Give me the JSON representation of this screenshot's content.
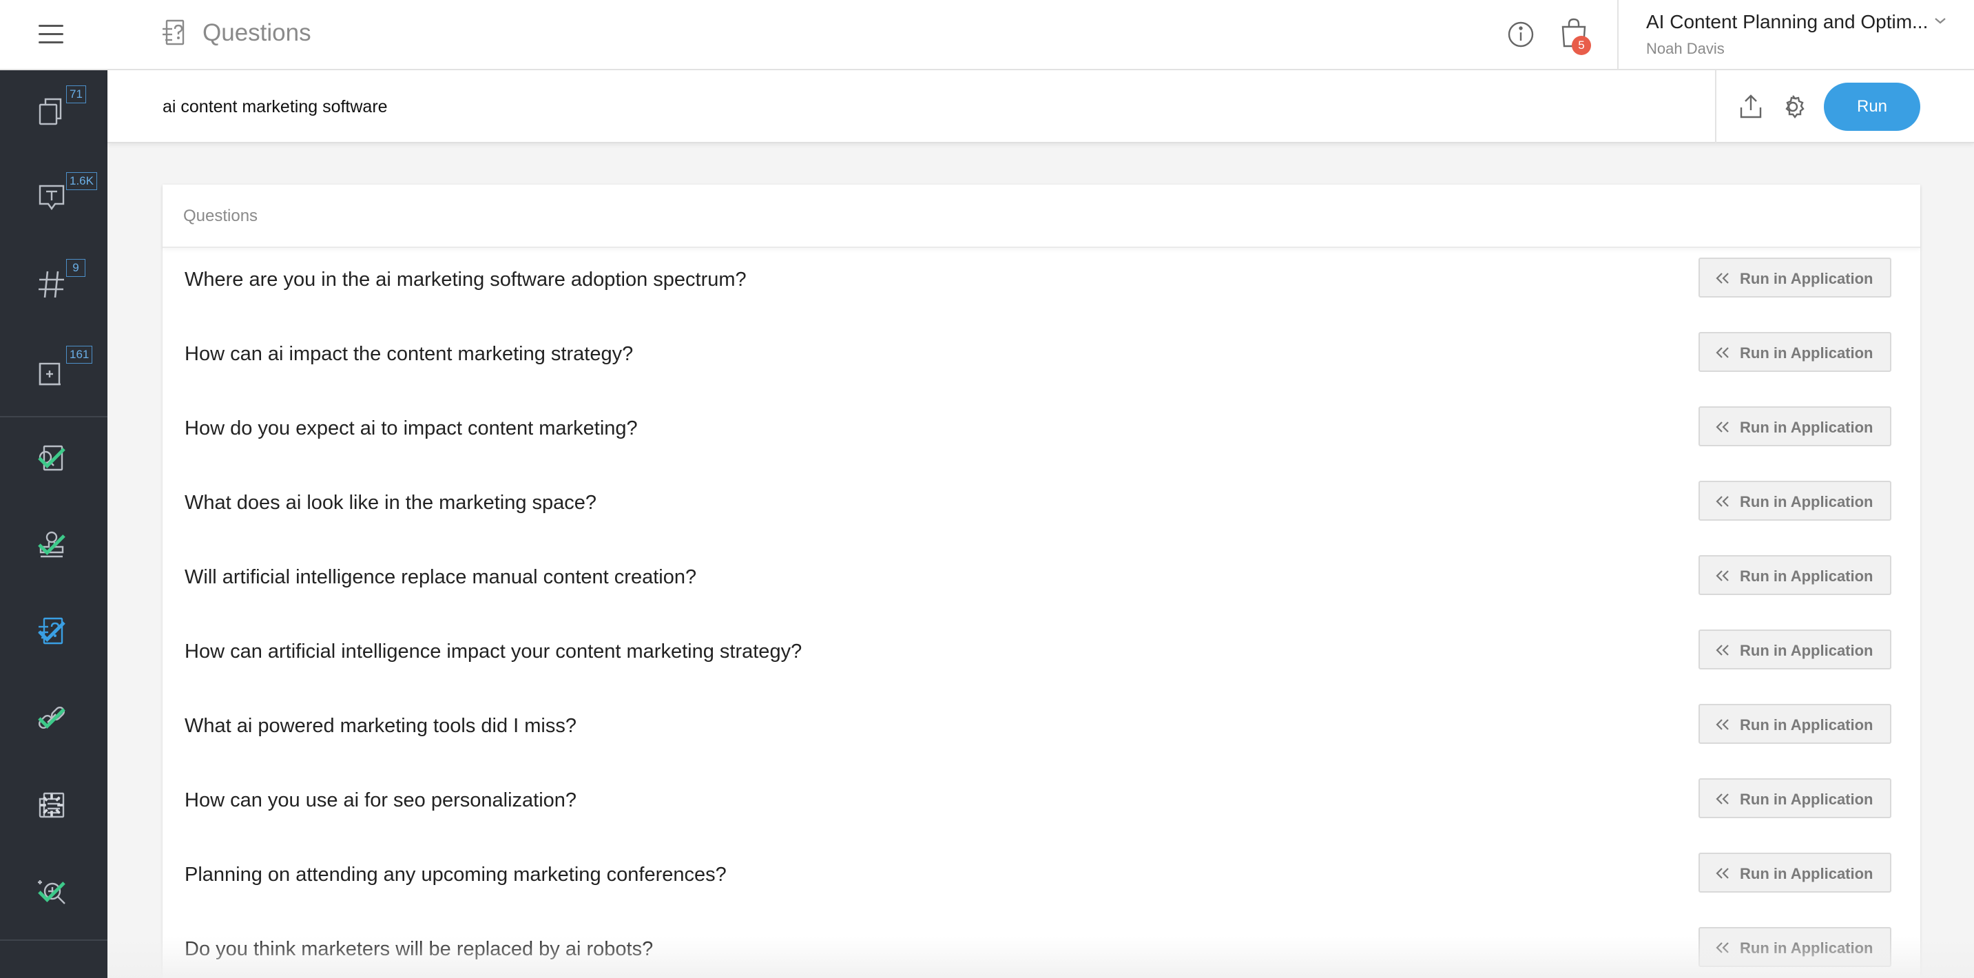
{
  "header": {
    "title": "Questions",
    "cart_count": "5",
    "project_name": "AI Content Planning and Optim...",
    "user_name": "Noah Davis"
  },
  "sidebar": {
    "badges": [
      "71",
      "1.6K",
      "9",
      "161"
    ],
    "items": [
      {
        "icon": "copy-icon",
        "badge": "71"
      },
      {
        "icon": "text-bubble-icon",
        "badge": "1.6K"
      },
      {
        "icon": "hashtag-icon",
        "badge": "9"
      },
      {
        "icon": "add-square-icon",
        "badge": "161"
      },
      {
        "icon": "search-doc-icon",
        "status": "done"
      },
      {
        "icon": "stamp-icon",
        "status": "done"
      },
      {
        "icon": "questions-icon",
        "status": "done",
        "active": true
      },
      {
        "icon": "link-icon",
        "status": "done"
      },
      {
        "icon": "news-icon",
        "status": "loading"
      },
      {
        "icon": "magnify-sparkle-icon",
        "status": "done"
      }
    ]
  },
  "query": {
    "value": "ai content marketing software"
  },
  "toolbar": {
    "run_label": "Run"
  },
  "card": {
    "header": "Questions",
    "button_label": "Run in Application",
    "questions": [
      "Where are you in the ai marketing software adoption spectrum?",
      "How can ai impact the content marketing strategy?",
      "How do you expect ai to impact content marketing?",
      "What does ai look like in the marketing space?",
      "Will artificial intelligence replace manual content creation?",
      "How can artificial intelligence impact your content marketing strategy?",
      "What ai powered marketing tools did I miss?",
      "How can you use ai for seo personalization?",
      "Planning on attending any upcoming marketing conferences?",
      "Do you think marketers will be replaced by ai robots?"
    ]
  },
  "colors": {
    "accent": "#3a9fe3",
    "sidebar_bg": "#2b2f36",
    "check": "#3ec98a",
    "badge_red": "#e85d4a"
  }
}
